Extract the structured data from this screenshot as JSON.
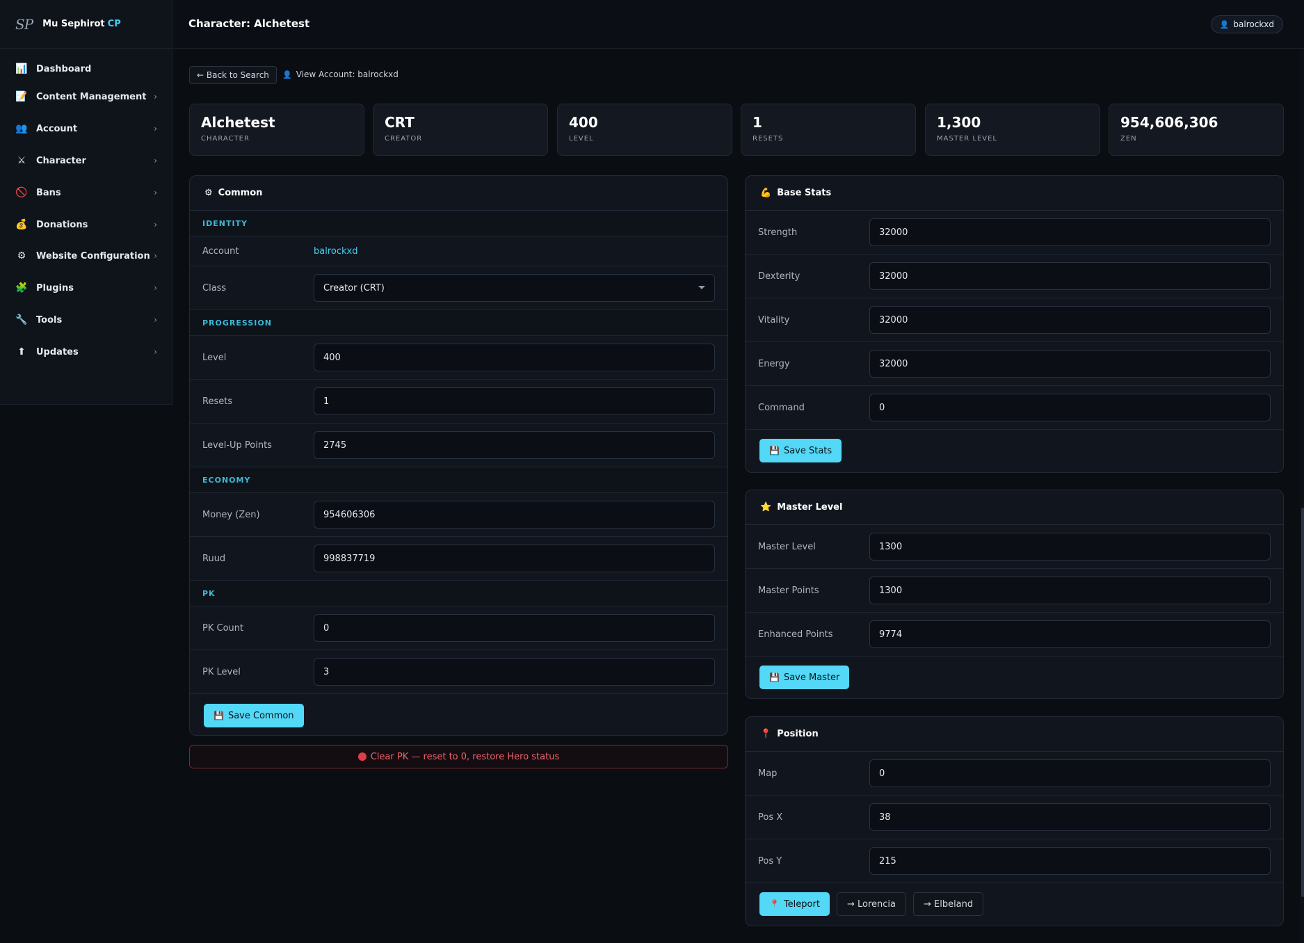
{
  "brand": {
    "logo": "SP",
    "name": "Mu Sephirot",
    "suffix": "CP"
  },
  "sidebar": {
    "items": [
      {
        "label": "Dashboard",
        "icon": "chart-icon",
        "glyph": "📊",
        "chevron": false
      },
      {
        "label": "Content Management",
        "icon": "document-icon",
        "glyph": "📝",
        "chevron": true
      },
      {
        "label": "Account",
        "icon": "users-icon",
        "glyph": "👥",
        "chevron": true
      },
      {
        "label": "Character",
        "icon": "swords-icon",
        "glyph": "⚔",
        "chevron": true
      },
      {
        "label": "Bans",
        "icon": "ban-icon",
        "glyph": "🚫",
        "chevron": true
      },
      {
        "label": "Donations",
        "icon": "money-bag-icon",
        "glyph": "💰",
        "chevron": true
      },
      {
        "label": "Website Configuration",
        "icon": "gear-icon",
        "glyph": "⚙",
        "chevron": true
      },
      {
        "label": "Plugins",
        "icon": "puzzle-icon",
        "glyph": "🧩",
        "chevron": true
      },
      {
        "label": "Tools",
        "icon": "wrench-icon",
        "glyph": "🔧",
        "chevron": true
      },
      {
        "label": "Updates",
        "icon": "up-arrow-icon",
        "glyph": "⬆",
        "chevron": true
      }
    ]
  },
  "header": {
    "title": "Character: Alchetest",
    "user": "balrockxd"
  },
  "actions": {
    "back": "← Back to Search",
    "view_account": "View Account: balrockxd"
  },
  "summary": [
    {
      "value": "Alchetest",
      "label": "Character"
    },
    {
      "value": "CRT",
      "label": "Creator"
    },
    {
      "value": "400",
      "label": "Level"
    },
    {
      "value": "1",
      "label": "Resets"
    },
    {
      "value": "1,300",
      "label": "Master Level"
    },
    {
      "value": "954,606,306",
      "label": "Zen"
    }
  ],
  "common": {
    "title": "Common",
    "identity_label": "Identity",
    "account_label": "Account",
    "account_value": "balrockxd",
    "class_label": "Class",
    "class_value": "Creator (CRT)",
    "progression_label": "Progression",
    "level_label": "Level",
    "level_value": "400",
    "resets_label": "Resets",
    "resets_value": "1",
    "points_label": "Level-Up Points",
    "points_value": "2745",
    "economy_label": "Economy",
    "money_label": "Money (Zen)",
    "money_value": "954606306",
    "ruud_label": "Ruud",
    "ruud_value": "998837719",
    "pk_label": "PK",
    "pkcount_label": "PK Count",
    "pkcount_value": "0",
    "pklevel_label": "PK Level",
    "pklevel_value": "3",
    "save_label": "Save Common"
  },
  "clear_pk": "Clear PK — reset to 0, restore Hero status",
  "base_stats": {
    "title": "Base Stats",
    "strength_label": "Strength",
    "strength_value": "32000",
    "dexterity_label": "Dexterity",
    "dexterity_value": "32000",
    "vitality_label": "Vitality",
    "vitality_value": "32000",
    "energy_label": "Energy",
    "energy_value": "32000",
    "command_label": "Command",
    "command_value": "0",
    "save_label": "Save Stats"
  },
  "master": {
    "title": "Master Level",
    "level_label": "Master Level",
    "level_value": "1300",
    "points_label": "Master Points",
    "points_value": "1300",
    "enhanced_label": "Enhanced Points",
    "enhanced_value": "9774",
    "save_label": "Save Master"
  },
  "position": {
    "title": "Position",
    "map_label": "Map",
    "map_value": "0",
    "x_label": "Pos X",
    "x_value": "38",
    "y_label": "Pos Y",
    "y_value": "215",
    "teleport_label": "Teleport",
    "lorencia_label": "→ Lorencia",
    "elbeland_label": "→ Elbeland"
  },
  "colors": {
    "accent": "#53d8f7",
    "link": "#3fd0f5",
    "danger": "#f0616d",
    "bg": "#0a0d12"
  }
}
